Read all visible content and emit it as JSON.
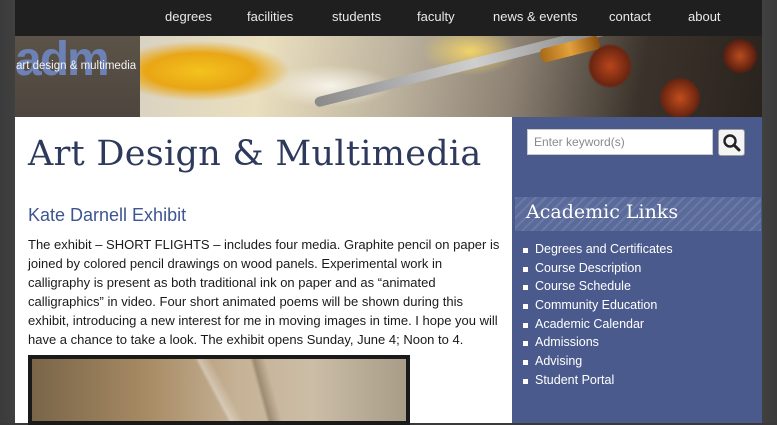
{
  "nav": {
    "items": [
      {
        "label": "degrees"
      },
      {
        "label": "facilities"
      },
      {
        "label": "students"
      },
      {
        "label": "faculty"
      },
      {
        "label": "news & events"
      },
      {
        "label": "contact"
      },
      {
        "label": "about"
      }
    ]
  },
  "banner": {
    "logo_mark": "adm",
    "logo_text": "art design & multimedia"
  },
  "main": {
    "page_title": "Art Design & Multimedia",
    "exhibit_title": "Kate Darnell Exhibit",
    "exhibit_body": "The exhibit – SHORT FLIGHTS – includes four media. Graphite pencil on paper is joined by colored pencil drawings on wood panels. Experimental work in calligraphy is present as both traditional ink on paper and as “animated calligraphics” in video. Four short animated poems will be shown during this exhibit, introducing a new interest for me in moving images in time. I hope you will have a chance to take a look. The exhibit opens Sunday, June 4; Noon to 4."
  },
  "sidebar": {
    "search": {
      "placeholder": "Enter keyword(s)",
      "value": ""
    },
    "academic_title": "Academic Links",
    "links": [
      {
        "label": "Degrees and Certificates"
      },
      {
        "label": "Course Description"
      },
      {
        "label": "Course Schedule"
      },
      {
        "label": "Community Education"
      },
      {
        "label": "Academic Calendar"
      },
      {
        "label": "Admissions"
      },
      {
        "label": "Advising"
      },
      {
        "label": "Student Portal"
      }
    ]
  },
  "colors": {
    "title_navy": "#2e3a5c",
    "subtitle_blue": "#3d5590",
    "sidebar_blue": "#4a5a8c",
    "nav_bg": "#1f1f1f"
  }
}
